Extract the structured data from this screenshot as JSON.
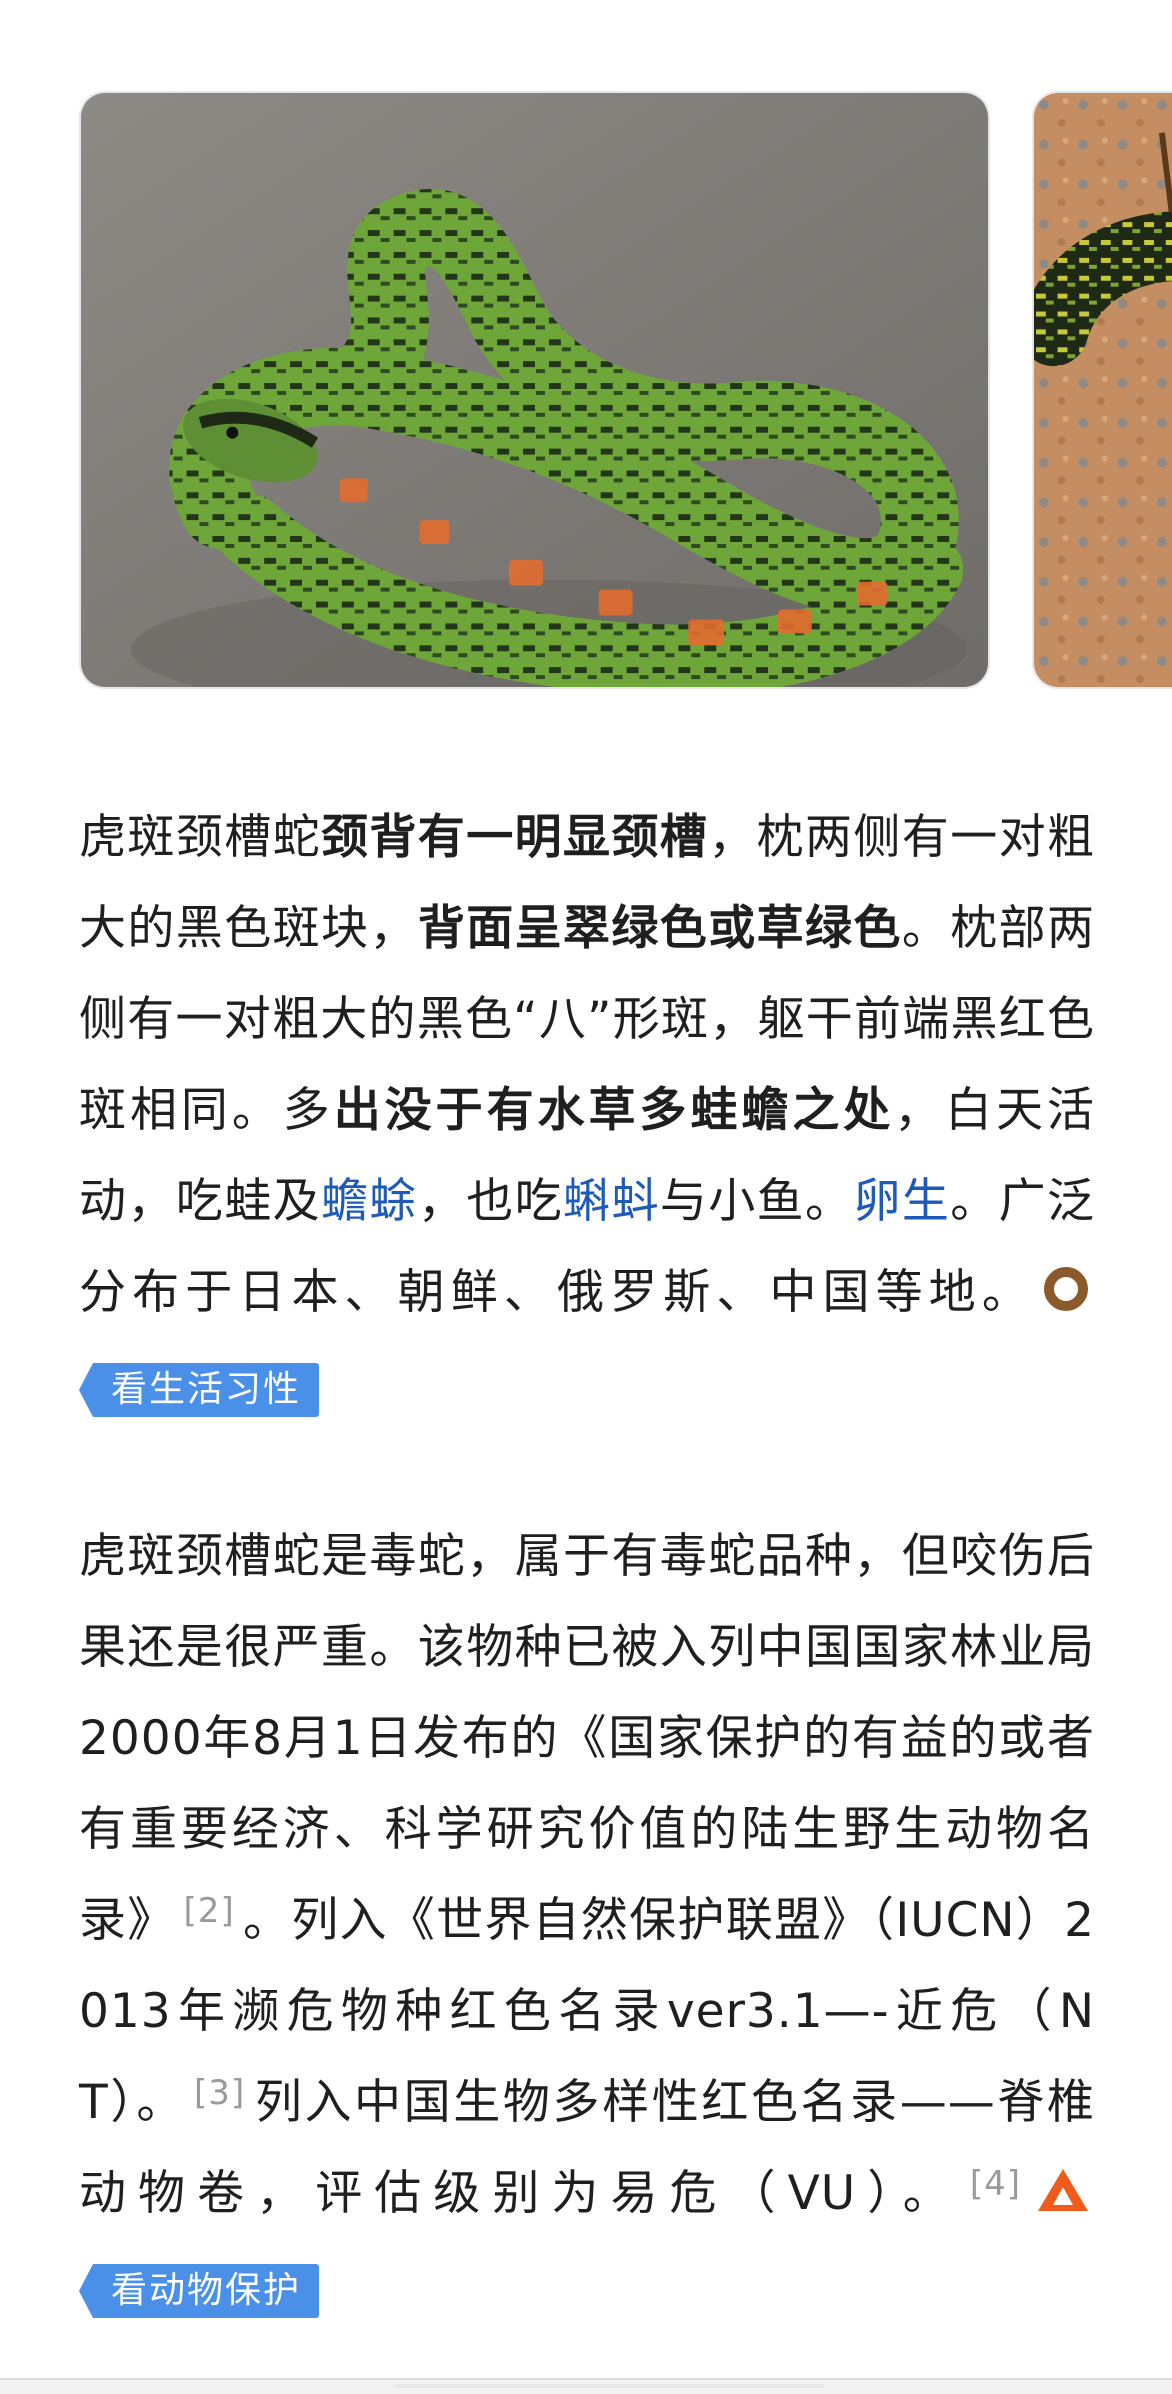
{
  "gallery": {
    "images": [
      {
        "alt": ""
      },
      {
        "alt": ""
      }
    ]
  },
  "paragraph_1": {
    "t1": "虎斑颈槽蛇",
    "b1": "颈背有一明显颈槽",
    "t2": "，枕两侧有一对粗大的黑色斑块，",
    "b2": "背面呈翠绿色或草绿色",
    "t3": "。枕部两侧有一对粗大的黑色“八”形斑，躯干前端黑红色斑相同。多",
    "b3": "出没于有水草多蛙蟾之处",
    "t4": "，白天活动，吃蛙及",
    "link1": "蟾蜍",
    "t5": "，也吃",
    "link2": "蝌蚪",
    "t6": "与小鱼。",
    "link3": "卵生",
    "t7": "。广泛分布于日本、朝鲜、俄罗斯、中国等地。",
    "chip_icon": "ring-icon",
    "chip_label": "看生活习性"
  },
  "paragraph_2": {
    "t1": "虎斑颈槽蛇是毒蛇，属于有毒蛇品种，但咬伤后果还是很严重。该物种已被入列中国国家林业局2000年8月1日发布的《国家保护的有益的或者有重要经济、科学研究价值的陆生野生动物名录》",
    "ref1": "[2]",
    "t2": "。列入《世界自然保护联盟》（IUCN）2013年濒危物种红色名录ver3.1—-近危（NT）。",
    "ref2": "[3]",
    "t3": "列入中国生物多样性红色名录——脊椎动物卷，评估级别为易危（VU）。",
    "ref3": "[4]",
    "chip_icon": "warning-triangle-icon",
    "chip_label": "看动物保护"
  },
  "colors": {
    "link": "#1e5bb8",
    "chip_bg": "#4a90e8",
    "ring_icon": "#8b5a2b",
    "triangle_icon": "#f05a1a"
  }
}
